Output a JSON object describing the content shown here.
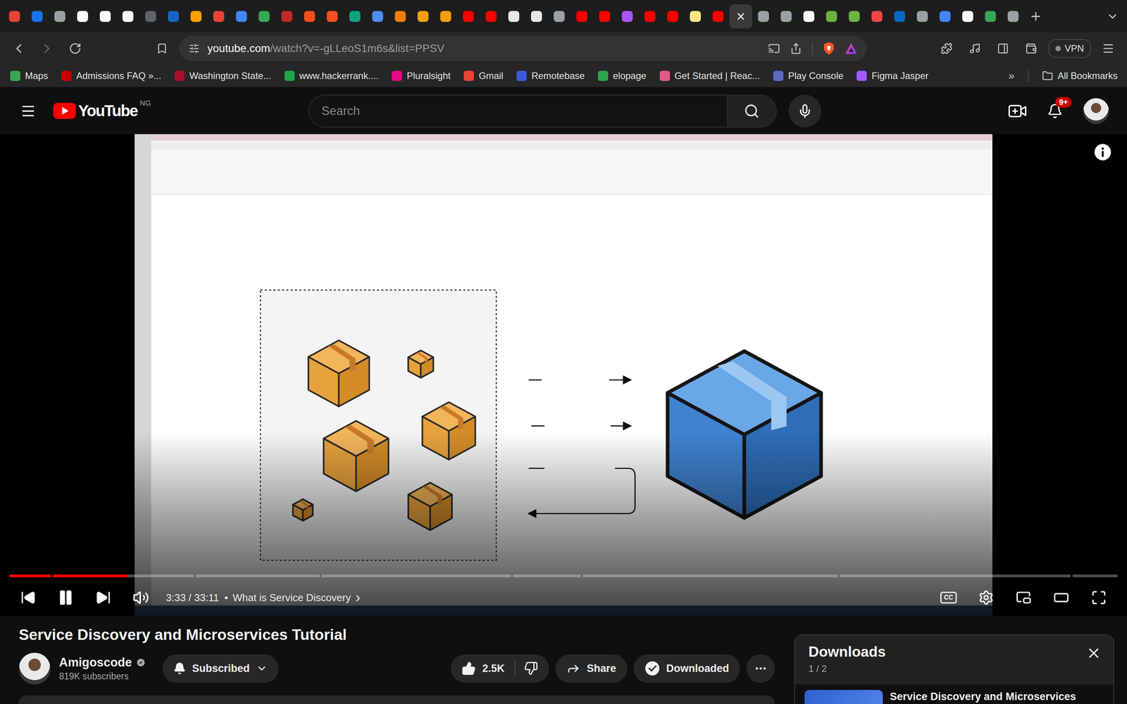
{
  "browser": {
    "tabs": [
      {
        "color": "#ea4335",
        "selected": false
      },
      {
        "color": "#1a73e8",
        "selected": false
      },
      {
        "color": "#9aa0a6",
        "selected": false
      },
      {
        "color": "#ffffff",
        "selected": false
      },
      {
        "color": "#ffffff",
        "selected": false
      },
      {
        "color": "#ffffff",
        "selected": false
      },
      {
        "color": "#5f6368",
        "selected": false
      },
      {
        "color": "#1565c0",
        "selected": false
      },
      {
        "color": "#ffa000",
        "selected": false
      },
      {
        "color": "#ea4335",
        "selected": false
      },
      {
        "color": "#4285f4",
        "selected": false
      },
      {
        "color": "#34a853",
        "selected": false
      },
      {
        "color": "#c62828",
        "selected": false
      },
      {
        "color": "#f24e1e",
        "selected": false
      },
      {
        "color": "#f24e1e",
        "selected": false
      },
      {
        "color": "#10a37f",
        "selected": false
      },
      {
        "color": "#4c8df6",
        "selected": false
      },
      {
        "color": "#f57c00",
        "selected": false
      },
      {
        "color": "#f59e0b",
        "selected": false
      },
      {
        "color": "#f59e0b",
        "selected": false
      },
      {
        "color": "#ff0000",
        "selected": false
      },
      {
        "color": "#ff0000",
        "selected": false
      },
      {
        "color": "#e8e8e8",
        "selected": false
      },
      {
        "color": "#e8e8e8",
        "selected": false
      },
      {
        "color": "#9aa0a6",
        "selected": false
      },
      {
        "color": "#ff0000",
        "selected": false
      },
      {
        "color": "#ff0000",
        "selected": false
      },
      {
        "color": "#a855f7",
        "selected": false
      },
      {
        "color": "#ff0000",
        "selected": false
      },
      {
        "color": "#ff0000",
        "selected": false
      },
      {
        "color": "#fde68a",
        "selected": false
      },
      {
        "color": "#ff0000",
        "selected": false
      },
      {
        "color": "#ffffff",
        "selected": true
      },
      {
        "color": "#9aa0a6",
        "selected": false
      },
      {
        "color": "#9aa0a6",
        "selected": false
      },
      {
        "color": "#ffffff",
        "selected": false
      },
      {
        "color": "#6db33f",
        "selected": false
      },
      {
        "color": "#6db33f",
        "selected": false
      },
      {
        "color": "#ef4444",
        "selected": false
      },
      {
        "color": "#0a66c2",
        "selected": false
      },
      {
        "color": "#9aa0a6",
        "selected": false
      },
      {
        "color": "#4285f4",
        "selected": false
      },
      {
        "color": "#ffffff",
        "selected": false
      },
      {
        "color": "#34a853",
        "selected": false
      },
      {
        "color": "#9aa0a6",
        "selected": false
      }
    ],
    "active_tab_close": "×",
    "url_host": "youtube.com",
    "url_path": "/watch?v=-gLLeoS1m6s&list=PPSV",
    "vpn": "VPN",
    "bookmarks": [
      {
        "label": "Maps",
        "color": "#34a853"
      },
      {
        "label": "Admissions FAQ »...",
        "color": "#cc0000"
      },
      {
        "label": "Washington State...",
        "color": "#a60f2d"
      },
      {
        "label": "www.hackerrank....",
        "color": "#1ba94c"
      },
      {
        "label": "Pluralsight",
        "color": "#e80a89"
      },
      {
        "label": "Gmail",
        "color": "#ea4335"
      },
      {
        "label": "Remotebase",
        "color": "#3b5bdb"
      },
      {
        "label": "elopage",
        "color": "#2ea44f"
      },
      {
        "label": "Get Started | Reac...",
        "color": "#e05a8a"
      },
      {
        "label": "Play Console",
        "color": "#5c6bc0"
      },
      {
        "label": "Figma Jasper",
        "color": "#a259ff"
      }
    ],
    "bookmarks_more": "»",
    "all_bookmarks": "All Bookmarks"
  },
  "youtube_header": {
    "logo": "YouTube",
    "region": "NG",
    "search_placeholder": "Search",
    "notification_count": "9+"
  },
  "player": {
    "playing": true,
    "muted": false,
    "progress": {
      "level": 0.107,
      "chapter_marks": [
        0.038,
        0.167,
        0.28,
        0.453,
        0.515,
        0.748,
        0.959
      ]
    },
    "time": "3:33 / 33:11",
    "separator": "•",
    "chapter": "What is Service Discovery",
    "chapter_arrow": "›",
    "captions": "CC"
  },
  "video": {
    "title": "Service Discovery and Microservices Tutorial",
    "channel": "Amigoscode",
    "verified": true,
    "subscribers": "819K subscribers",
    "subscribe_label": "Subscribed",
    "likes": "2.5K",
    "share": "Share",
    "download": "Downloaded"
  },
  "downloads": {
    "title": "Downloads",
    "count": "1 / 2",
    "items": [
      {
        "title": "Service Discovery and Microservices"
      }
    ]
  }
}
